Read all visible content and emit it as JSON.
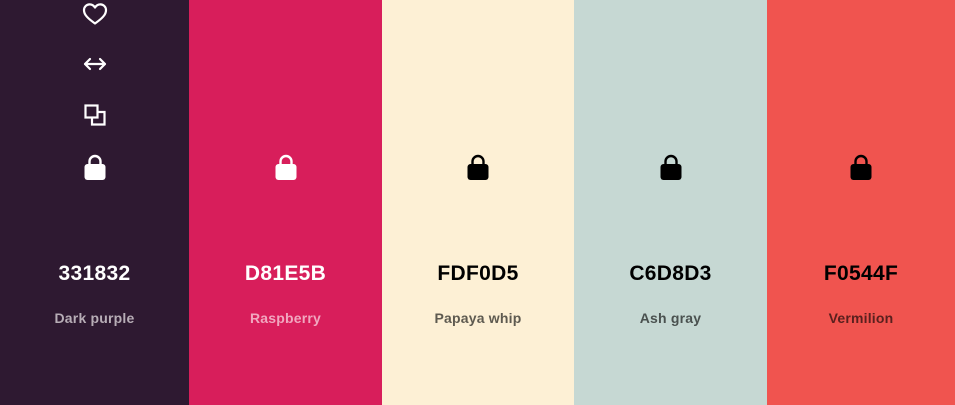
{
  "palette": {
    "colors": [
      {
        "hex": "331832",
        "name": "Dark purple",
        "background": "#2E1931",
        "text_color": "#FFFFFF",
        "name_color": "#B7ADB6",
        "icon_color": "#FFFFFF",
        "icons": [
          "heart-icon",
          "arrows-horizontal-icon",
          "copy-icon",
          "lock-icon"
        ]
      },
      {
        "hex": "D81E5B",
        "name": "Raspberry",
        "background": "#D81E5B",
        "text_color": "#FFFFFF",
        "name_color": "#F1A7BF",
        "icon_color": "#FFFFFF",
        "icons": [
          "lock-icon"
        ]
      },
      {
        "hex": "FDF0D5",
        "name": "Papaya whip",
        "background": "#FDF0D5",
        "text_color": "#000000",
        "name_color": "#5E5A50",
        "icon_color": "#000000",
        "icons": [
          "lock-icon"
        ]
      },
      {
        "hex": "C6D8D3",
        "name": "Ash gray",
        "background": "#C6D8D3",
        "text_color": "#000000",
        "name_color": "#4A514F",
        "icon_color": "#000000",
        "icons": [
          "lock-icon"
        ]
      },
      {
        "hex": "F0544F",
        "name": "Vermilion",
        "background": "#F0544F",
        "text_color": "#000000",
        "name_color": "#5A201E",
        "icon_color": "#000000",
        "icons": [
          "lock-icon"
        ]
      }
    ]
  }
}
